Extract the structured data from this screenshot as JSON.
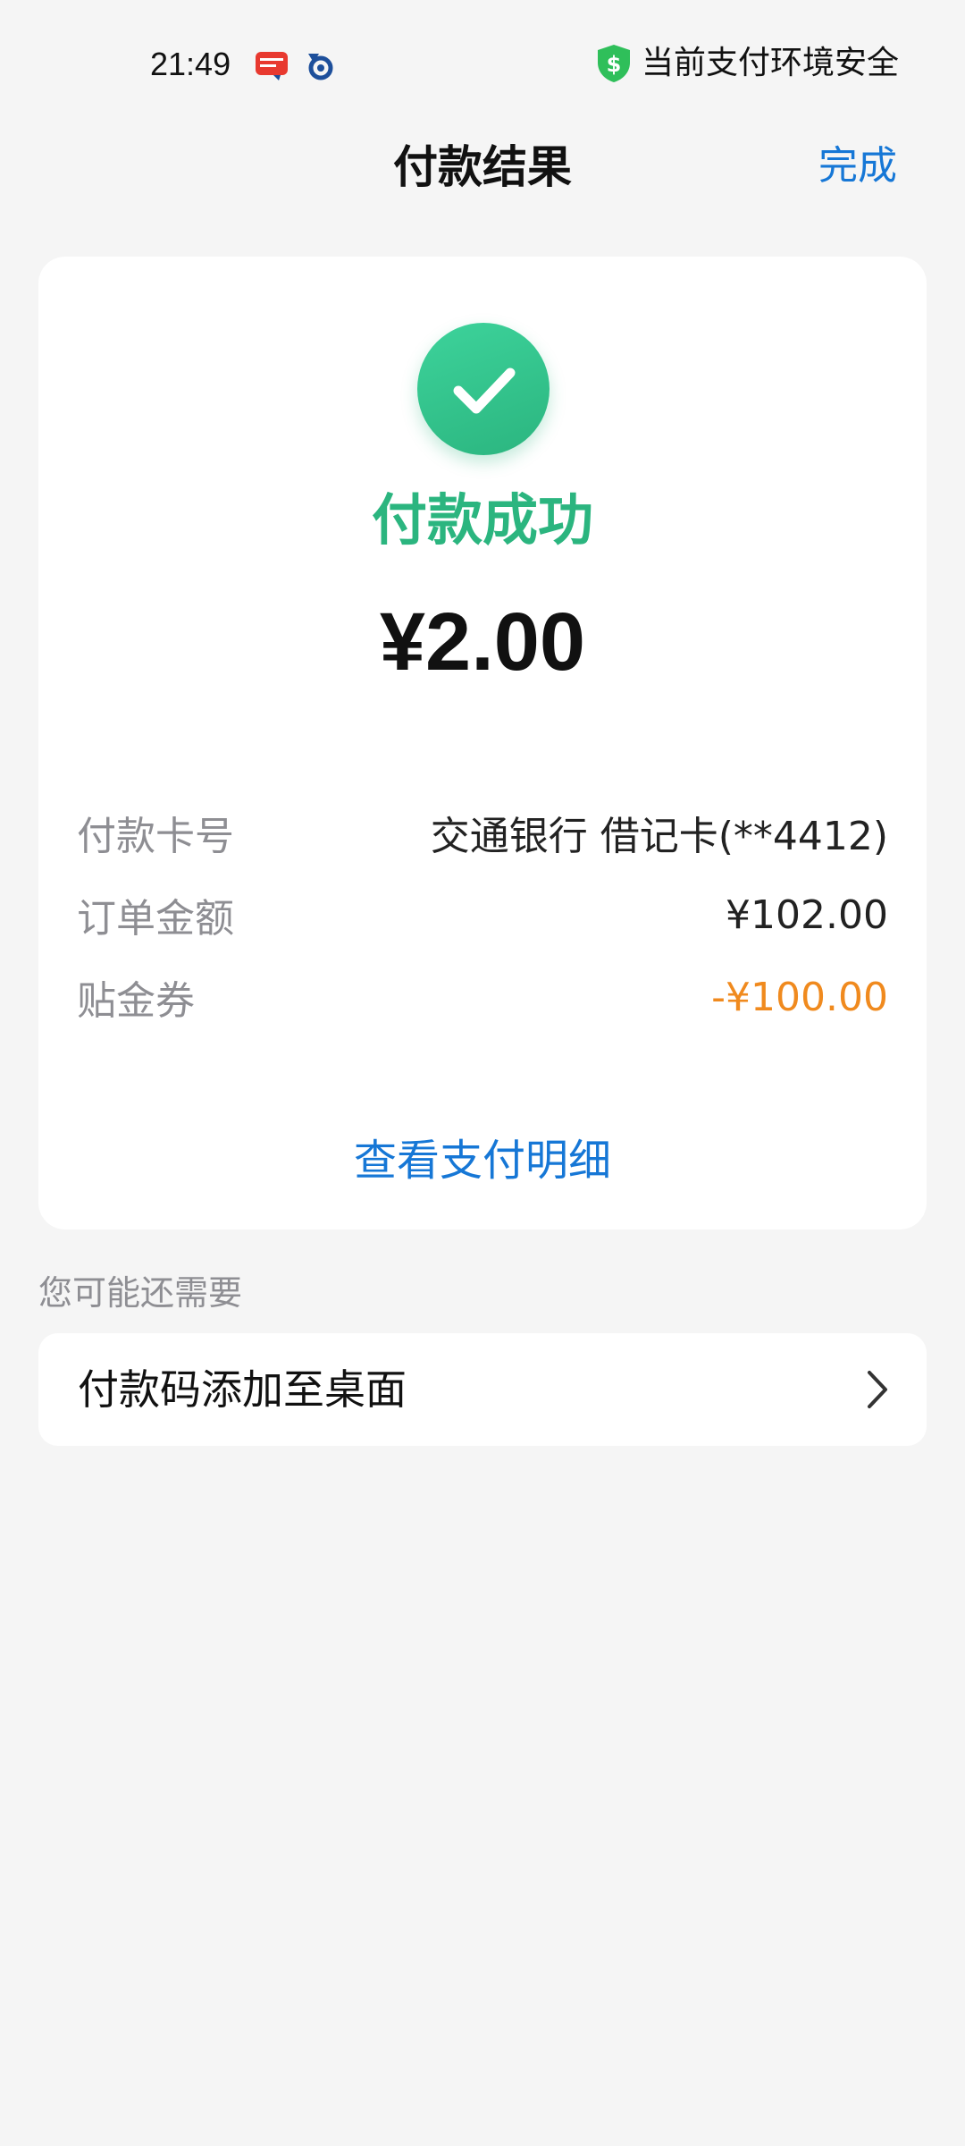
{
  "status_bar": {
    "time": "21:49",
    "app_icons": [
      "cloud-pay-notification-icon",
      "bank-app-notification-icon"
    ],
    "security_icon": "shield-dollar-icon",
    "security_text": "当前支付环境安全"
  },
  "header": {
    "title": "付款结果",
    "done_label": "完成"
  },
  "result": {
    "status_icon": "check-circle-icon",
    "status_text": "付款成功",
    "amount": "¥2.00",
    "details": [
      {
        "label": "付款卡号",
        "value": "交通银行 借记卡(**4412)"
      },
      {
        "label": "订单金额",
        "value": "¥102.00"
      },
      {
        "label": "贴金券",
        "value": "-¥100.00"
      }
    ],
    "view_detail_label": "查看支付明细"
  },
  "suggestions": {
    "section_title": "您可能还需要",
    "items": [
      {
        "label": "付款码添加至桌面",
        "icon": "chevron-right-icon"
      }
    ]
  },
  "colors": {
    "success": "#2bb57f",
    "link": "#1677d6",
    "discount": "#f08a1e",
    "label_gray": "#8e8e93",
    "background": "#f5f5f5",
    "shield": "#2fbf5a"
  }
}
